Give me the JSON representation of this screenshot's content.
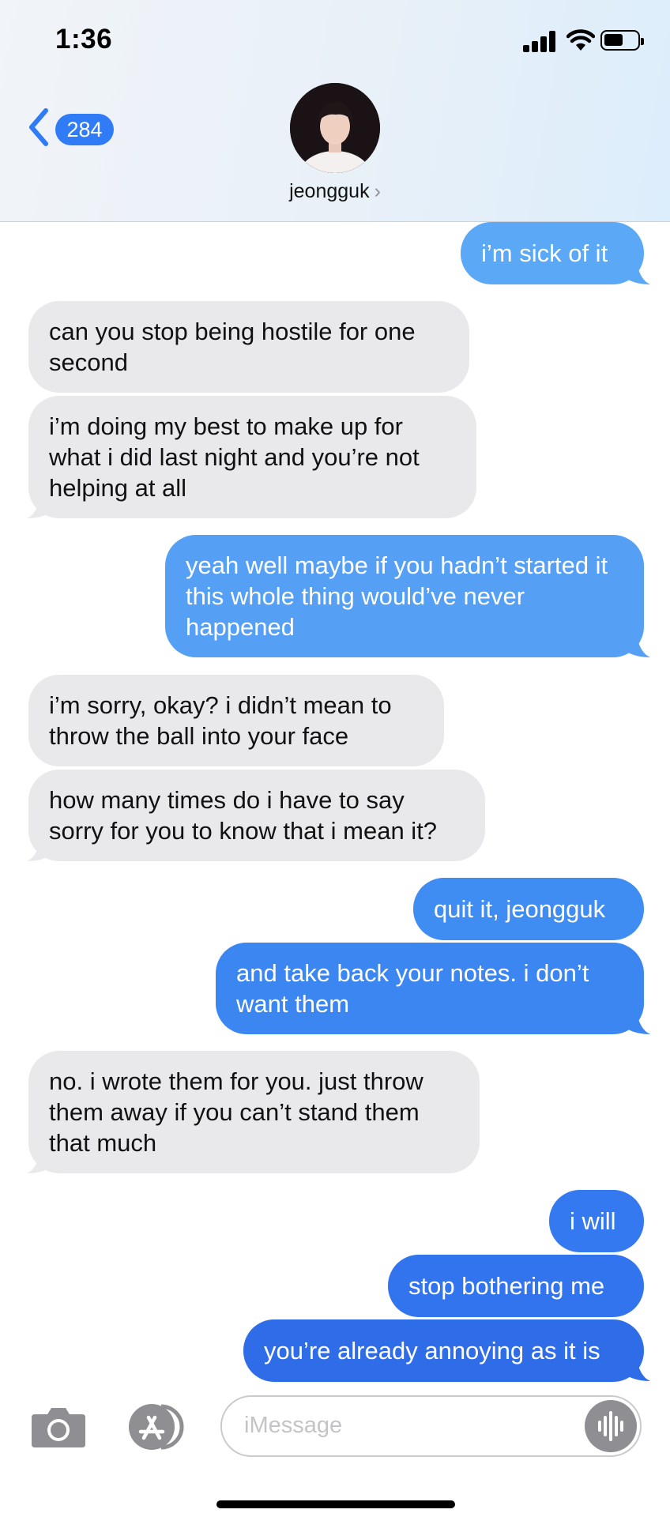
{
  "status_bar": {
    "time": "1:36"
  },
  "header": {
    "back_count": "284",
    "contact_name": "jeongguk",
    "chevron": "›"
  },
  "messages": [
    {
      "from": "me",
      "text": "i’m sick of it"
    },
    {
      "from": "them",
      "text": "can you stop being hostile for one second"
    },
    {
      "from": "them",
      "text": "i’m doing my best to make up for what i did last night and you’re not helping at all"
    },
    {
      "from": "me",
      "text": "yeah well maybe if you hadn’t started it this whole thing would’ve never happened"
    },
    {
      "from": "them",
      "text": "i’m sorry, okay? i didn’t mean to throw the ball into your face"
    },
    {
      "from": "them",
      "text": "how many times do i have to say sorry for you to know that i mean it?"
    },
    {
      "from": "me",
      "text": "quit it, jeongguk"
    },
    {
      "from": "me",
      "text": "and take back your notes. i don’t want them"
    },
    {
      "from": "them",
      "text": "no. i wrote them for you. just throw them away if you can’t stand them that much"
    },
    {
      "from": "me",
      "text": "i will"
    },
    {
      "from": "me",
      "text": "stop bothering me"
    },
    {
      "from": "me",
      "text": "you’re already annoying as it is"
    }
  ],
  "composer": {
    "placeholder": "iMessage"
  },
  "colors": {
    "accent": "#2f7cf6",
    "incoming_bubble": "#e9e9eb",
    "outgoing_light": "#5aa8f6",
    "outgoing_dark": "#2f6de8"
  },
  "icons": [
    "back-chevron-icon",
    "camera-icon",
    "app-store-icon",
    "audio-waveform-icon",
    "signal-icon",
    "wifi-icon",
    "battery-icon"
  ]
}
